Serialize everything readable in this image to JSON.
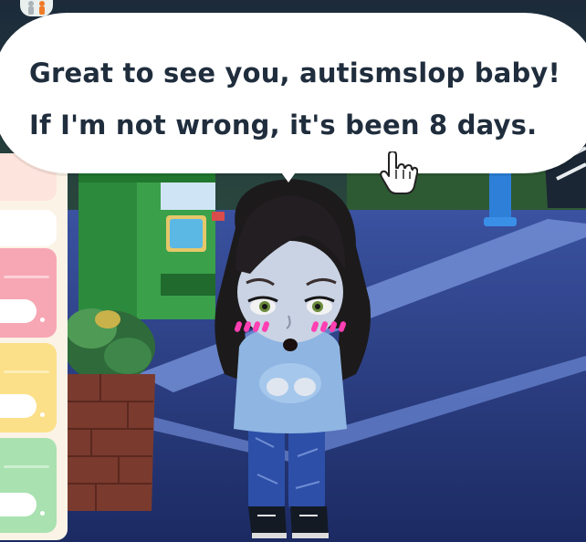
{
  "dialogue": {
    "line1": "Great to see you, autismslop baby!",
    "line2": "If I'm not wrong, it's been 8 days."
  },
  "sidebar": {
    "tabs": [
      {
        "name": "sidebar-tab-peach",
        "color": "#fde4dc"
      },
      {
        "name": "sidebar-tab-white",
        "color": "#ffffff"
      },
      {
        "name": "sidebar-tab-pink",
        "color": "#f7a7b4"
      },
      {
        "name": "sidebar-tab-yellow",
        "color": "#fbe089"
      },
      {
        "name": "sidebar-tab-green",
        "color": "#a9e1b0"
      }
    ]
  },
  "icons": {
    "top_left": "people-icon",
    "cursor": "pointing-hand-icon"
  },
  "colors": {
    "speech_text": "#1f2d3d",
    "speech_bubble": "#ffffff",
    "plaza_floor": "#33478c",
    "vending_machine": "#2f8a3f"
  }
}
